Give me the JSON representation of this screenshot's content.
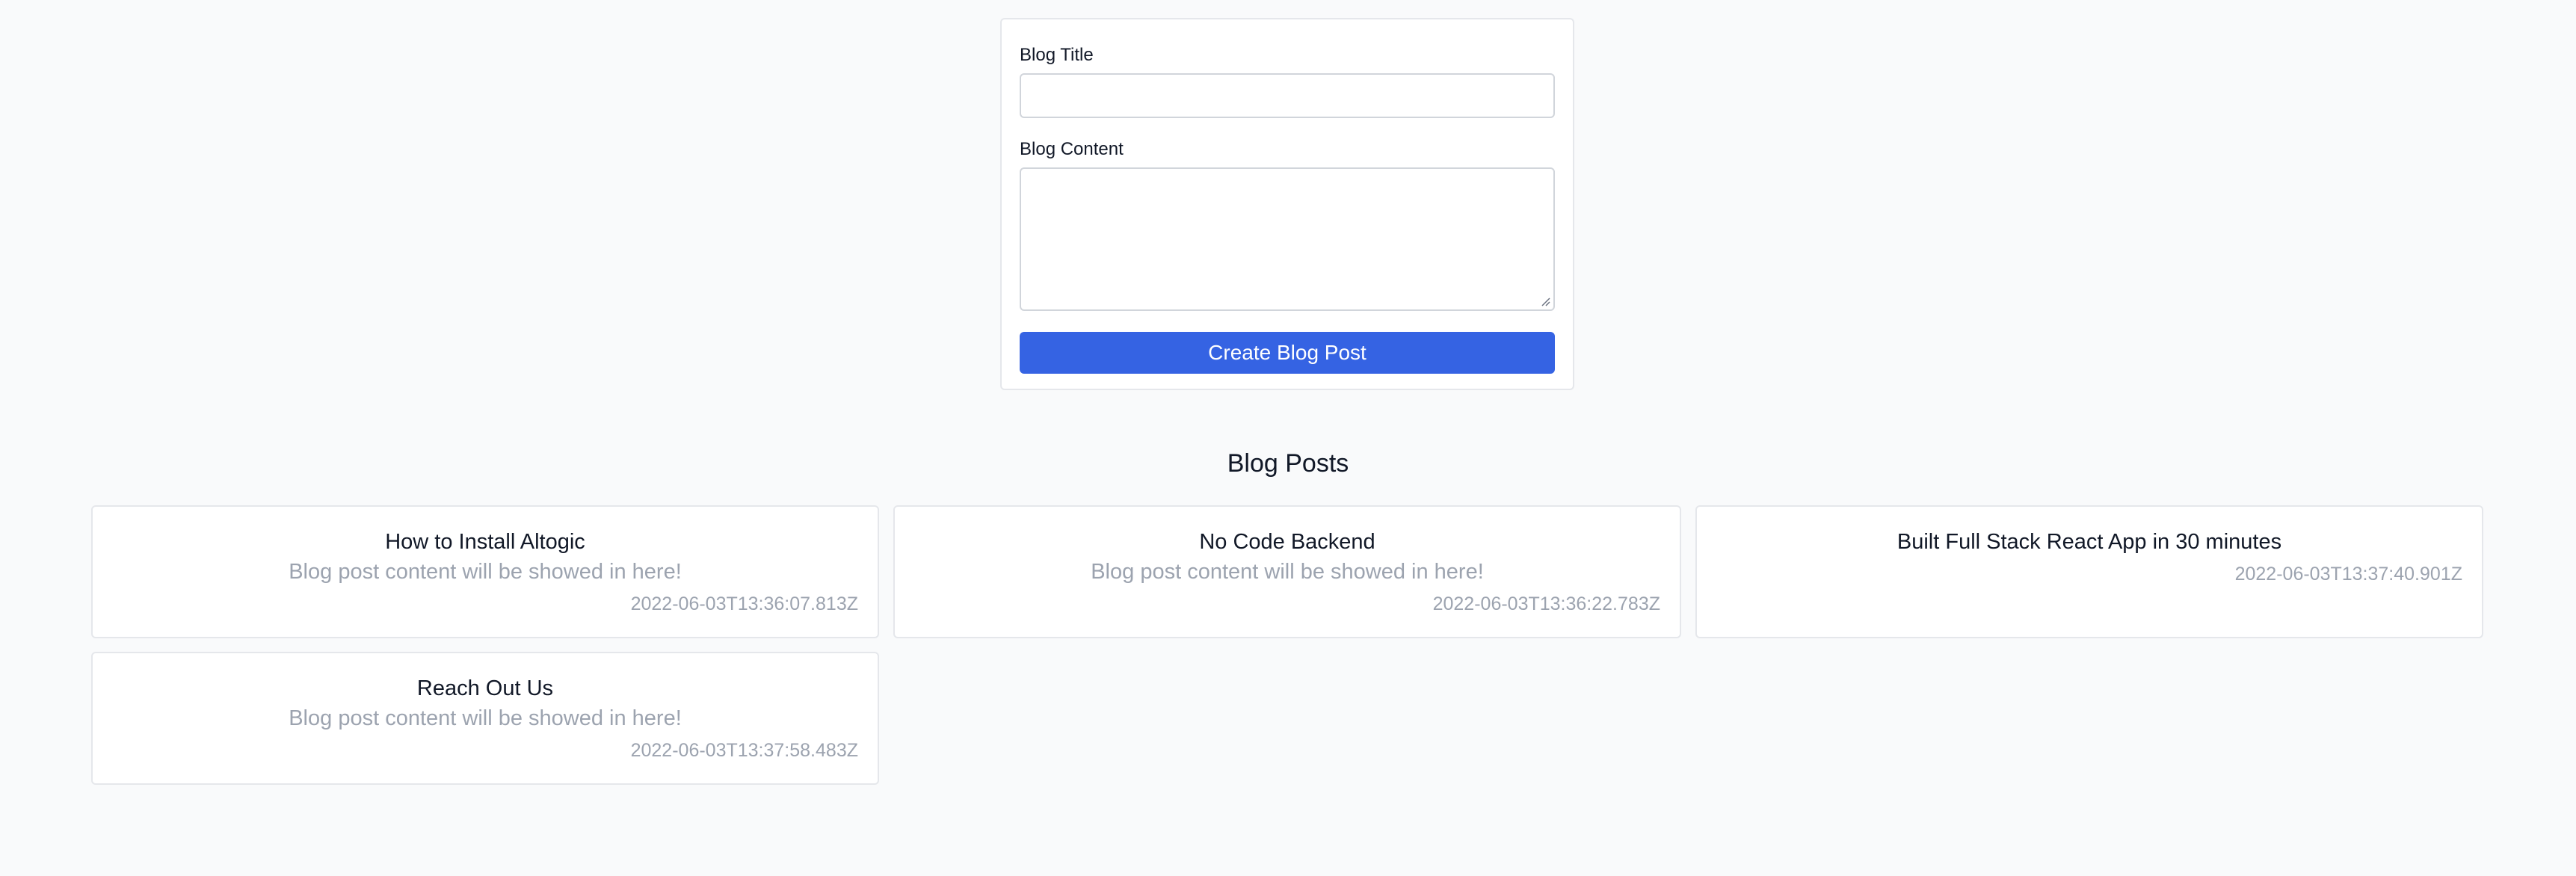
{
  "form": {
    "title_label": "Blog Title",
    "title_value": "",
    "content_label": "Blog Content",
    "content_value": "",
    "submit_label": "Create Blog Post"
  },
  "posts_section": {
    "heading": "Blog Posts",
    "posts": [
      {
        "title": "How to Install Altogic",
        "content": "Blog post content will be showed in here!",
        "date": "2022-06-03T13:36:07.813Z"
      },
      {
        "title": "No Code Backend",
        "content": "Blog post content will be showed in here!",
        "date": "2022-06-03T13:36:22.783Z"
      },
      {
        "title": "Built Full Stack React App in 30 minutes",
        "content": "",
        "date": "2022-06-03T13:37:40.901Z"
      },
      {
        "title": "Reach Out Us",
        "content": "Blog post content will be showed in here!",
        "date": "2022-06-03T13:37:58.483Z"
      }
    ]
  },
  "colors": {
    "page_background": "#f9fafb",
    "primary_button": "#3563e3",
    "muted_text": "#9ca3af",
    "border": "#e5e7eb"
  }
}
